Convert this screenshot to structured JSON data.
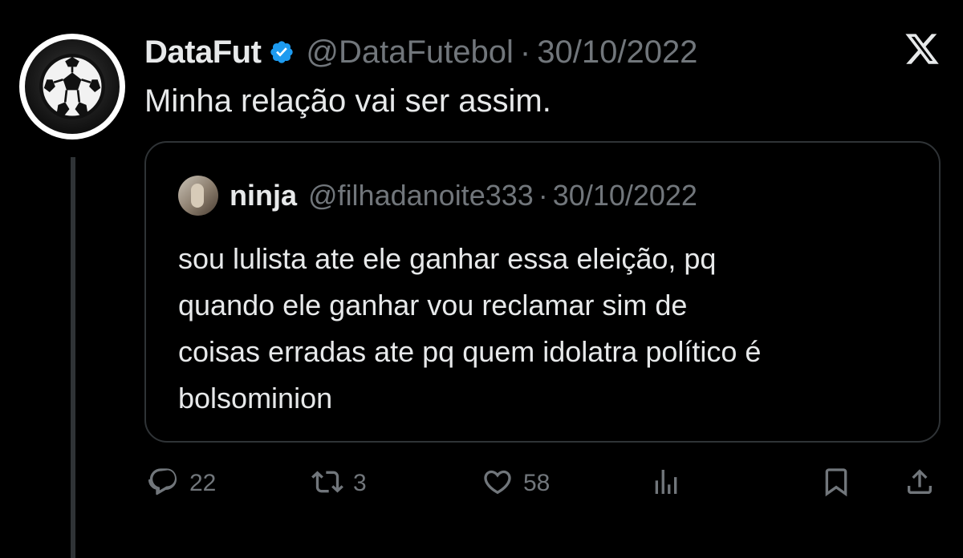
{
  "post": {
    "author_name": "DataFut",
    "author_handle": "@DataFutebol",
    "separator": "·",
    "date": "30/10/2022",
    "text": "Minha relação vai ser assim."
  },
  "quoted": {
    "author_name": "ninja",
    "author_handle": "@filhadanoite333",
    "separator": "·",
    "date": "30/10/2022",
    "lines": [
      "sou lulista ate ele ganhar essa eleição, pq",
      "quando ele ganhar vou reclamar sim de",
      "coisas erradas ate pq quem idolatra político é",
      "bolsominion"
    ]
  },
  "actions": {
    "replies": "22",
    "reposts": "3",
    "likes": "58"
  },
  "icons": {
    "verified": "verified-badge-icon",
    "brand": "x-logo-icon",
    "reply": "reply-icon",
    "repost": "repost-icon",
    "like": "heart-icon",
    "views": "views-chart-icon",
    "bookmark": "bookmark-icon",
    "share": "share-icon"
  },
  "colors": {
    "background": "#000000",
    "text_primary": "#e7e9ea",
    "text_secondary": "#71767b",
    "verified_blue": "#1d9bf0",
    "border": "#2f3336"
  }
}
